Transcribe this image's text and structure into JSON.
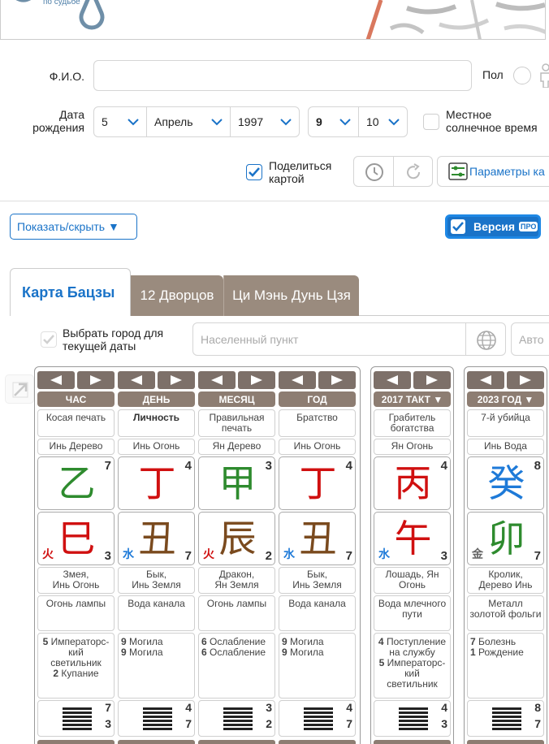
{
  "header": {
    "logo_subtitle": "по судьбе"
  },
  "form": {
    "name_label": "Ф.И.О.",
    "name_value": "",
    "gender_label": "Пол",
    "birth_label_1": "Дата",
    "birth_label_2": "рождения",
    "day": "5",
    "month": "Апрель",
    "year": "1997",
    "hour": "9",
    "minute": "10",
    "solar_label_1": "Местное",
    "solar_label_2": "солнечное время",
    "share_label_1": "Поделиться",
    "share_label_2": "картой",
    "params_label": "Параметры ка"
  },
  "toolbar": {
    "toggle_label": "Показать/скрыть ▼",
    "version_label": "Версия",
    "pro_badge": "ПРО"
  },
  "tabs": [
    {
      "label": "Карта Бацзы"
    },
    {
      "label": "12 Дворцов"
    },
    {
      "label": "Ци Мэнь Дунь Цзя"
    }
  ],
  "city": {
    "label_1": "Выбрать город для",
    "label_2": "текущей даты",
    "placeholder": "Населенный пункт",
    "auto_placeholder": "Авто"
  },
  "columns": [
    {
      "header": "ЧАС",
      "ten_god": "Косая печать",
      "hidden": "Инь Дерево",
      "stem": "乙",
      "stem_color": "#2e8b2e",
      "stem_num": "7",
      "branch": "巳",
      "branch_color": "#d01010",
      "branch_num": "3",
      "element": "火",
      "element_color": "#d01010",
      "animal_1": "Змея,",
      "animal_2": "Инь Огонь",
      "nayin": "Огонь лампы",
      "stage_1n": "5",
      "stage_1": "Императорс-",
      "stage_1b": "кий",
      "stage_1c": "светильник",
      "stage_2n": "2",
      "stage_2": "Купание",
      "hex_top": "7",
      "hex_bot": "3"
    },
    {
      "header": "ДЕНЬ",
      "ten_god": "Личность",
      "hidden": "Инь Огонь",
      "stem": "丁",
      "stem_color": "#d01010",
      "stem_num": "4",
      "branch": "丑",
      "branch_color": "#7a4a1e",
      "branch_num": "7",
      "element": "水",
      "element_color": "#1e7ad8",
      "animal_1": "Бык,",
      "animal_2": "Инь Земля",
      "nayin": "Вода канала",
      "stage_1n": "9",
      "stage_1": "Могила",
      "stage_1b": "",
      "stage_1c": "",
      "stage_2n": "9",
      "stage_2": "Могила",
      "hex_top": "4",
      "hex_bot": "7"
    },
    {
      "header": "МЕСЯЦ",
      "ten_god": "Правильная печать",
      "hidden": "Ян Дерево",
      "stem": "甲",
      "stem_color": "#2e8b2e",
      "stem_num": "3",
      "branch": "辰",
      "branch_color": "#7a4a1e",
      "branch_num": "2",
      "element": "火",
      "element_color": "#d01010",
      "animal_1": "Дракон,",
      "animal_2": "Ян Земля",
      "nayin": "Огонь лампы",
      "stage_1n": "6",
      "stage_1": "Ослабление",
      "stage_1b": "",
      "stage_1c": "",
      "stage_2n": "6",
      "stage_2": "Ослабление",
      "hex_top": "3",
      "hex_bot": "2"
    },
    {
      "header": "ГОД",
      "ten_god": "Братство",
      "hidden": "Инь Огонь",
      "stem": "丁",
      "stem_color": "#d01010",
      "stem_num": "4",
      "branch": "丑",
      "branch_color": "#7a4a1e",
      "branch_num": "7",
      "element": "水",
      "element_color": "#1e7ad8",
      "animal_1": "Бык,",
      "animal_2": "Инь Земля",
      "nayin": "Вода канала",
      "stage_1n": "9",
      "stage_1": "Могила",
      "stage_1b": "",
      "stage_1c": "",
      "stage_2n": "9",
      "stage_2": "Могила",
      "hex_top": "4",
      "hex_bot": "7"
    },
    {
      "header": "2017 ТАКТ ▼",
      "ten_god": "Грабитель богатства",
      "hidden": "Ян Огонь",
      "stem": "丙",
      "stem_color": "#d01010",
      "stem_num": "4",
      "branch": "午",
      "branch_color": "#d01010",
      "branch_num": "3",
      "element": "水",
      "element_color": "#1e7ad8",
      "animal_1": "Лошадь, Ян",
      "animal_2": "Огонь",
      "nayin": "Вода млечного пути",
      "stage_1n": "4",
      "stage_1": "Поступление",
      "stage_1b": "на службу",
      "stage_1c": "",
      "stage_2n": "5",
      "stage_2": "Императорс-",
      "stage_2b": "кий",
      "stage_2c": "светильник",
      "hex_top": "4",
      "hex_bot": "3"
    },
    {
      "header": "2023 ГОД ▼",
      "ten_god": "7-й убийца",
      "hidden": "Инь Вода",
      "stem": "癸",
      "stem_color": "#1e7ad8",
      "stem_num": "8",
      "branch": "卯",
      "branch_color": "#2e8b2e",
      "branch_num": "7",
      "element": "金",
      "element_color": "#666666",
      "animal_1": "Кролик,",
      "animal_2": "Дерево Инь",
      "nayin": "Металл золотой фольги",
      "stage_1n": "7",
      "stage_1": "Болезнь",
      "stage_1b": "",
      "stage_1c": "",
      "stage_2n": "1",
      "stage_2": "Рождение",
      "hex_top": "8",
      "hex_bot": "7"
    }
  ]
}
